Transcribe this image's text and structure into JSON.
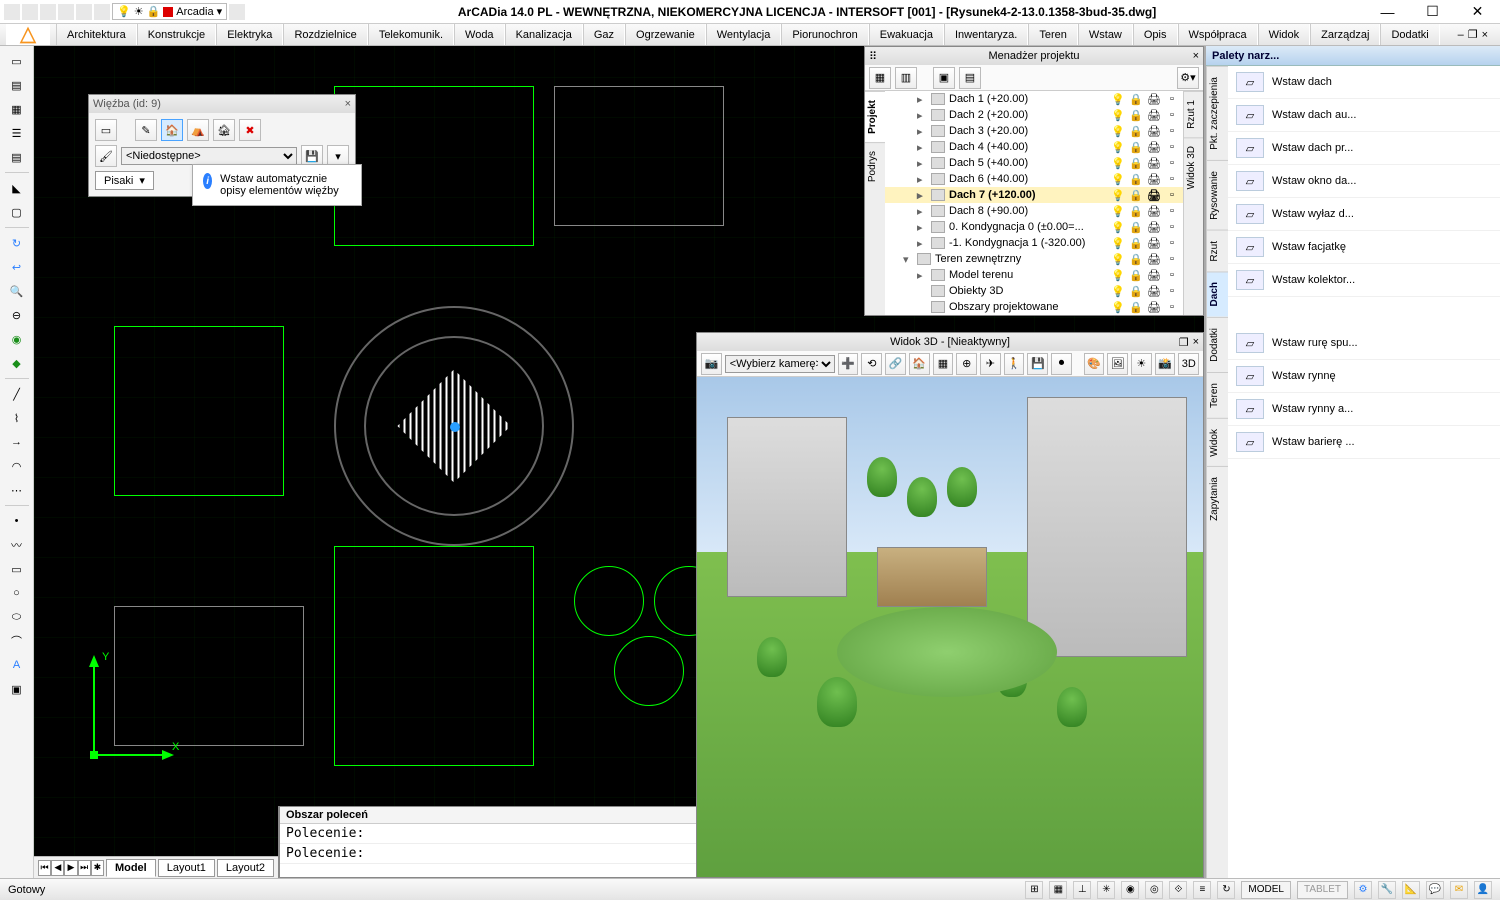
{
  "titlebar": {
    "title": "ArCADia 14.0 PL - WEWNĘTRZNA, NIEKOMERCYJNA LICENCJA - INTERSOFT [001] - [Rysunek4-2-13.0.1358-3bud-35.dwg]",
    "layer_name": "Arcadia"
  },
  "menu": {
    "items": [
      "Architektura",
      "Konstrukcje",
      "Elektryka",
      "Rozdzielnice",
      "Telekomunik.",
      "Woda",
      "Kanalizacja",
      "Gaz",
      "Ogrzewanie",
      "Wentylacja",
      "Piorunochron",
      "Ewakuacja",
      "Inwentaryza.",
      "Teren",
      "Wstaw",
      "Opis",
      "Współpraca",
      "Widok",
      "Zarządzaj",
      "Dodatki"
    ]
  },
  "wiezba": {
    "title": "Więźba (id: 9)",
    "dropdown_placeholder": "<Niedostępne>",
    "pisaki_label": "Pisaki",
    "tooltip": "Wstaw automatycznie opisy elementów więźby"
  },
  "cmd": {
    "header": "Obszar poleceń",
    "prompt": "Polecenie:"
  },
  "tabs": {
    "items": [
      "Model",
      "Layout1",
      "Layout2"
    ],
    "active": 0
  },
  "projmgr": {
    "title": "Menadżer projektu",
    "side_tabs": [
      "Projekt",
      "Podrys",
      "Rzut 1",
      "Widok 3D"
    ],
    "tree": [
      {
        "label": "Dach 1 (+20.00)",
        "indent": 2,
        "exp": ">"
      },
      {
        "label": "Dach 2 (+20.00)",
        "indent": 2,
        "exp": ">"
      },
      {
        "label": "Dach 3 (+20.00)",
        "indent": 2,
        "exp": ">"
      },
      {
        "label": "Dach 4 (+40.00)",
        "indent": 2,
        "exp": ">"
      },
      {
        "label": "Dach 5 (+40.00)",
        "indent": 2,
        "exp": ">"
      },
      {
        "label": "Dach 6 (+40.00)",
        "indent": 2,
        "exp": ">"
      },
      {
        "label": "Dach 7 (+120.00)",
        "indent": 2,
        "exp": ">",
        "sel": true
      },
      {
        "label": "Dach 8 (+90.00)",
        "indent": 2,
        "exp": ">"
      },
      {
        "label": "0. Kondygnacja 0 (±0.00=...",
        "indent": 2,
        "exp": ">"
      },
      {
        "label": "-1. Kondygnacja 1 (-320.00)",
        "indent": 2,
        "exp": ">"
      },
      {
        "label": "Teren zewnętrzny",
        "indent": 1,
        "exp": "v"
      },
      {
        "label": "Model terenu",
        "indent": 2,
        "exp": ">"
      },
      {
        "label": "Obiekty 3D",
        "indent": 2,
        "exp": ""
      },
      {
        "label": "Obszary projektowane",
        "indent": 2,
        "exp": ""
      }
    ]
  },
  "view3d": {
    "title": "Widok 3D - [Nieaktywny]",
    "camera_placeholder": "<Wybierz kamerę>"
  },
  "palette": {
    "title": "Palety narz...",
    "cats": [
      "Pkt. zaczepienia",
      "Rysowanie",
      "Rzut",
      "Dach",
      "Dodatki",
      "Teren",
      "Widok",
      "Zapytania"
    ],
    "active_cat": 3,
    "items": [
      "Wstaw dach",
      "Wstaw dach au...",
      "Wstaw dach pr...",
      "Wstaw okno da...",
      "Wstaw wyłaz d...",
      "Wstaw facjatkę",
      "Wstaw kolektor...",
      "Wstaw rurę spu...",
      "Wstaw rynnę",
      "Wstaw rynny a...",
      "Wstaw barierę ..."
    ]
  },
  "status": {
    "ready": "Gotowy",
    "model_btn": "MODEL",
    "tablet_btn": "TABLET"
  },
  "axis": {
    "x": "X",
    "y": "Y"
  }
}
